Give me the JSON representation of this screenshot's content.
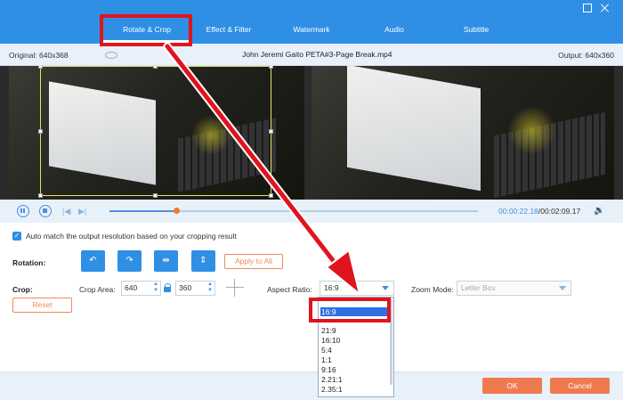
{
  "tabs": [
    "Rotate & Crop",
    "Effect & Filter",
    "Watermark",
    "Audio",
    "Subtitle"
  ],
  "info": {
    "original": "Original: 640x368",
    "filename": "John Jeremi Gaito PETA#3-Page Break.mp4",
    "output": "Output: 640x360"
  },
  "playback": {
    "current_time": "00:00:22.18",
    "total_time": "/00:02:09.17",
    "progress": 0.18
  },
  "settings": {
    "auto_match_label": "Auto match the output resolution based on your cropping result",
    "auto_match_checked": true,
    "rotation_label": "Rotation:",
    "rotation_buttons": [
      "rotate-left",
      "rotate-right",
      "flip-horizontal",
      "flip-vertical"
    ],
    "apply_all_label": "Apply to All",
    "crop_label": "Crop:",
    "crop_area_label": "Crop Area:",
    "crop_width": "640",
    "crop_height": "360",
    "aspect_ratio_label": "Aspect Ratio:",
    "aspect_ratio_value": "16:9",
    "zoom_mode_label": "Zoom Mode:",
    "zoom_mode_value": "Letter Box",
    "reset_label": "Reset"
  },
  "dropdown_options": [
    "16:9",
    "21:9",
    "16:10",
    "5:4",
    "1:1",
    "9:16",
    "2.21:1",
    "2.35:1"
  ],
  "footer": {
    "ok_label": "OK",
    "cancel_label": "Cancel"
  },
  "colors": {
    "accent": "#2f8fe4",
    "action": "#f07a50",
    "annotation": "#e0141e"
  }
}
